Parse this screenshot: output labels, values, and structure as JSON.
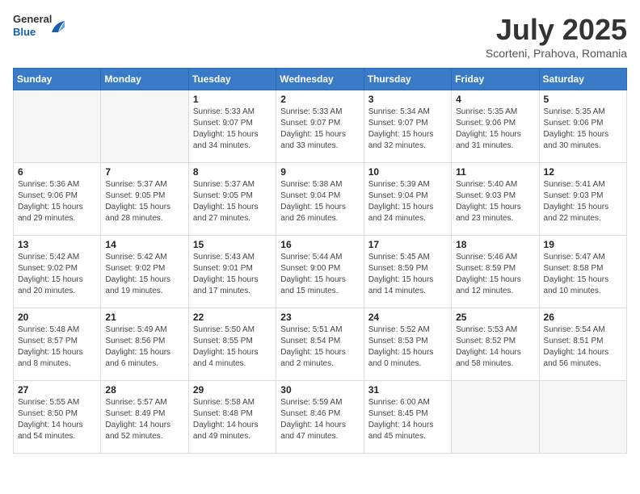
{
  "logo": {
    "general": "General",
    "blue": "Blue"
  },
  "title": {
    "month_year": "July 2025",
    "location": "Scorteni, Prahova, Romania"
  },
  "calendar": {
    "headers": [
      "Sunday",
      "Monday",
      "Tuesday",
      "Wednesday",
      "Thursday",
      "Friday",
      "Saturday"
    ],
    "weeks": [
      [
        {
          "day": "",
          "info": ""
        },
        {
          "day": "",
          "info": ""
        },
        {
          "day": "1",
          "info": "Sunrise: 5:33 AM\nSunset: 9:07 PM\nDaylight: 15 hours and 34 minutes."
        },
        {
          "day": "2",
          "info": "Sunrise: 5:33 AM\nSunset: 9:07 PM\nDaylight: 15 hours and 33 minutes."
        },
        {
          "day": "3",
          "info": "Sunrise: 5:34 AM\nSunset: 9:07 PM\nDaylight: 15 hours and 32 minutes."
        },
        {
          "day": "4",
          "info": "Sunrise: 5:35 AM\nSunset: 9:06 PM\nDaylight: 15 hours and 31 minutes."
        },
        {
          "day": "5",
          "info": "Sunrise: 5:35 AM\nSunset: 9:06 PM\nDaylight: 15 hours and 30 minutes."
        }
      ],
      [
        {
          "day": "6",
          "info": "Sunrise: 5:36 AM\nSunset: 9:06 PM\nDaylight: 15 hours and 29 minutes."
        },
        {
          "day": "7",
          "info": "Sunrise: 5:37 AM\nSunset: 9:05 PM\nDaylight: 15 hours and 28 minutes."
        },
        {
          "day": "8",
          "info": "Sunrise: 5:37 AM\nSunset: 9:05 PM\nDaylight: 15 hours and 27 minutes."
        },
        {
          "day": "9",
          "info": "Sunrise: 5:38 AM\nSunset: 9:04 PM\nDaylight: 15 hours and 26 minutes."
        },
        {
          "day": "10",
          "info": "Sunrise: 5:39 AM\nSunset: 9:04 PM\nDaylight: 15 hours and 24 minutes."
        },
        {
          "day": "11",
          "info": "Sunrise: 5:40 AM\nSunset: 9:03 PM\nDaylight: 15 hours and 23 minutes."
        },
        {
          "day": "12",
          "info": "Sunrise: 5:41 AM\nSunset: 9:03 PM\nDaylight: 15 hours and 22 minutes."
        }
      ],
      [
        {
          "day": "13",
          "info": "Sunrise: 5:42 AM\nSunset: 9:02 PM\nDaylight: 15 hours and 20 minutes."
        },
        {
          "day": "14",
          "info": "Sunrise: 5:42 AM\nSunset: 9:02 PM\nDaylight: 15 hours and 19 minutes."
        },
        {
          "day": "15",
          "info": "Sunrise: 5:43 AM\nSunset: 9:01 PM\nDaylight: 15 hours and 17 minutes."
        },
        {
          "day": "16",
          "info": "Sunrise: 5:44 AM\nSunset: 9:00 PM\nDaylight: 15 hours and 15 minutes."
        },
        {
          "day": "17",
          "info": "Sunrise: 5:45 AM\nSunset: 8:59 PM\nDaylight: 15 hours and 14 minutes."
        },
        {
          "day": "18",
          "info": "Sunrise: 5:46 AM\nSunset: 8:59 PM\nDaylight: 15 hours and 12 minutes."
        },
        {
          "day": "19",
          "info": "Sunrise: 5:47 AM\nSunset: 8:58 PM\nDaylight: 15 hours and 10 minutes."
        }
      ],
      [
        {
          "day": "20",
          "info": "Sunrise: 5:48 AM\nSunset: 8:57 PM\nDaylight: 15 hours and 8 minutes."
        },
        {
          "day": "21",
          "info": "Sunrise: 5:49 AM\nSunset: 8:56 PM\nDaylight: 15 hours and 6 minutes."
        },
        {
          "day": "22",
          "info": "Sunrise: 5:50 AM\nSunset: 8:55 PM\nDaylight: 15 hours and 4 minutes."
        },
        {
          "day": "23",
          "info": "Sunrise: 5:51 AM\nSunset: 8:54 PM\nDaylight: 15 hours and 2 minutes."
        },
        {
          "day": "24",
          "info": "Sunrise: 5:52 AM\nSunset: 8:53 PM\nDaylight: 15 hours and 0 minutes."
        },
        {
          "day": "25",
          "info": "Sunrise: 5:53 AM\nSunset: 8:52 PM\nDaylight: 14 hours and 58 minutes."
        },
        {
          "day": "26",
          "info": "Sunrise: 5:54 AM\nSunset: 8:51 PM\nDaylight: 14 hours and 56 minutes."
        }
      ],
      [
        {
          "day": "27",
          "info": "Sunrise: 5:55 AM\nSunset: 8:50 PM\nDaylight: 14 hours and 54 minutes."
        },
        {
          "day": "28",
          "info": "Sunrise: 5:57 AM\nSunset: 8:49 PM\nDaylight: 14 hours and 52 minutes."
        },
        {
          "day": "29",
          "info": "Sunrise: 5:58 AM\nSunset: 8:48 PM\nDaylight: 14 hours and 49 minutes."
        },
        {
          "day": "30",
          "info": "Sunrise: 5:59 AM\nSunset: 8:46 PM\nDaylight: 14 hours and 47 minutes."
        },
        {
          "day": "31",
          "info": "Sunrise: 6:00 AM\nSunset: 8:45 PM\nDaylight: 14 hours and 45 minutes."
        },
        {
          "day": "",
          "info": ""
        },
        {
          "day": "",
          "info": ""
        }
      ]
    ]
  }
}
